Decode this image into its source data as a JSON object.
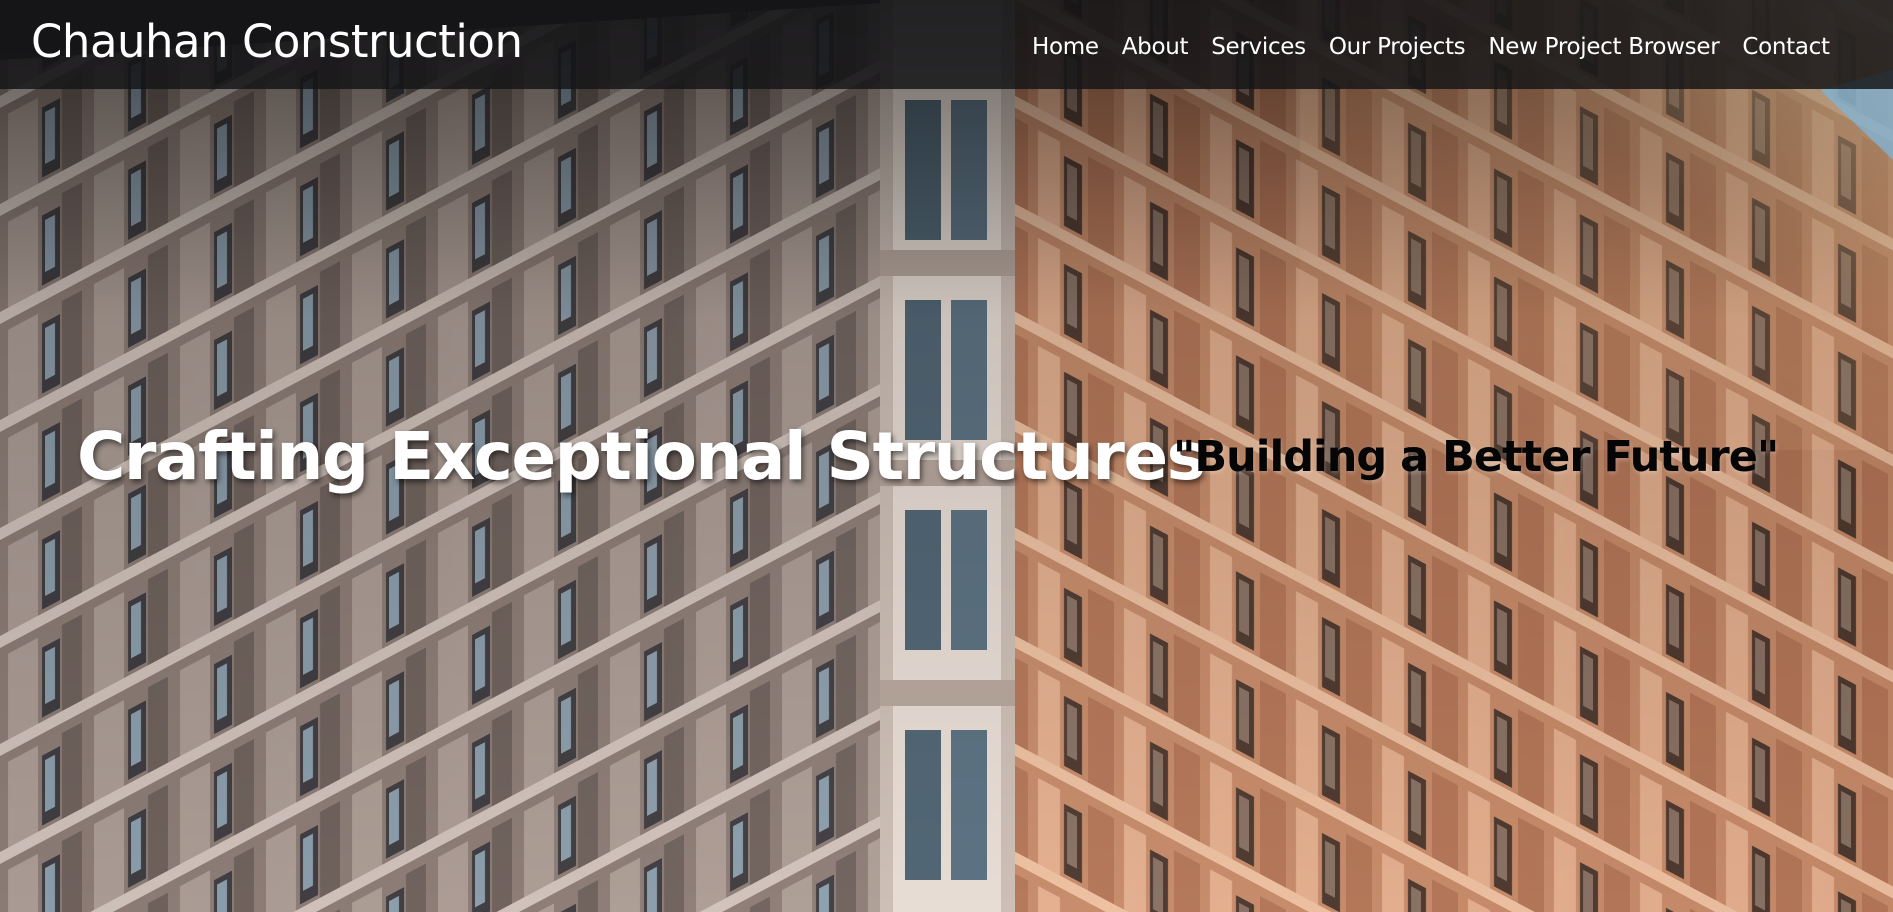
{
  "header": {
    "brand": "Chauhan Construction",
    "nav": {
      "home": "Home",
      "about": "About",
      "services": "Services",
      "projects": "Our Projects",
      "browser": "New Project Browser",
      "contact": "Contact"
    }
  },
  "hero": {
    "headline": "Crafting Exceptional Structures",
    "tagline": "\"Building a Better Future\""
  },
  "colors": {
    "header_bg": "#161618",
    "text_light": "#ffffff",
    "text_dark": "#050505",
    "facade_left": "#8d7b72",
    "facade_right": "#c78c6a"
  },
  "icons": {
    "background": "building-facade-photo"
  }
}
